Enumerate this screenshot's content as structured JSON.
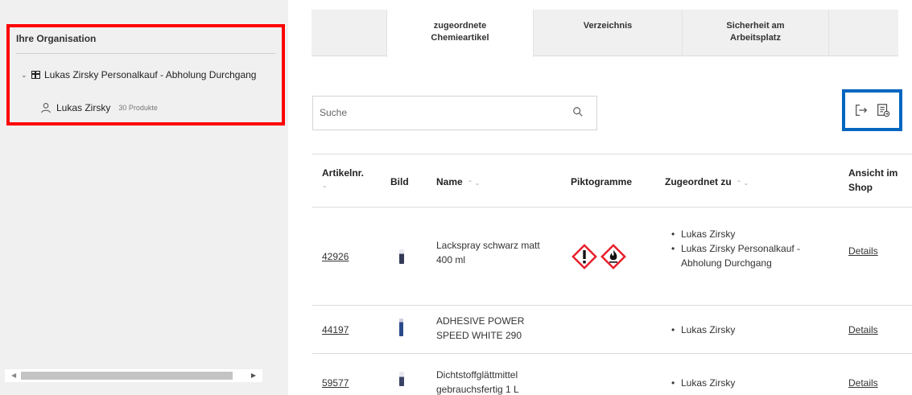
{
  "sidebar": {
    "title": "Ihre Organisation",
    "org_node": "Lukas Zirsky Personalkauf - Abholung Durchgang",
    "user": {
      "name": "Lukas Zirsky",
      "count": "30 Produkte"
    }
  },
  "tabs": [
    {
      "label": "zugeordnete Chemieartikel",
      "active": true
    },
    {
      "label": "Verzeichnis",
      "active": false
    },
    {
      "label": "Sicherheit am Arbeitsplatz",
      "active": false
    }
  ],
  "search": {
    "placeholder": "Suche"
  },
  "table": {
    "headers": {
      "artikelnr": "Artikelnr.",
      "bild": "Bild",
      "name": "Name",
      "piktogramme": "Piktogramme",
      "zugeordnet": "Zugeordnet zu",
      "ansicht": "Ansicht im Shop"
    },
    "rows": [
      {
        "nr": "42926",
        "name": "Lackspray schwarz matt 400 ml",
        "assigned": [
          "Lukas Zirsky",
          "Lukas Zirsky Personalkauf - Abholung Durchgang"
        ],
        "details": "Details",
        "pictograms": [
          "exclamation-mark-icon",
          "flame-icon"
        ]
      },
      {
        "nr": "44197",
        "name": "ADHESIVE POWER SPEED WHITE 290",
        "assigned": [
          "Lukas Zirsky"
        ],
        "details": "Details",
        "pictograms": []
      },
      {
        "nr": "59577",
        "name": "Dichtstoffglättmittel gebrauchsfertig 1 L",
        "assigned": [
          "Lukas Zirsky"
        ],
        "details": "Details",
        "pictograms": []
      }
    ]
  },
  "colors": {
    "highlight_red": "#ff0000",
    "highlight_blue": "#0066c0",
    "ghs_red": "#e8202a"
  }
}
